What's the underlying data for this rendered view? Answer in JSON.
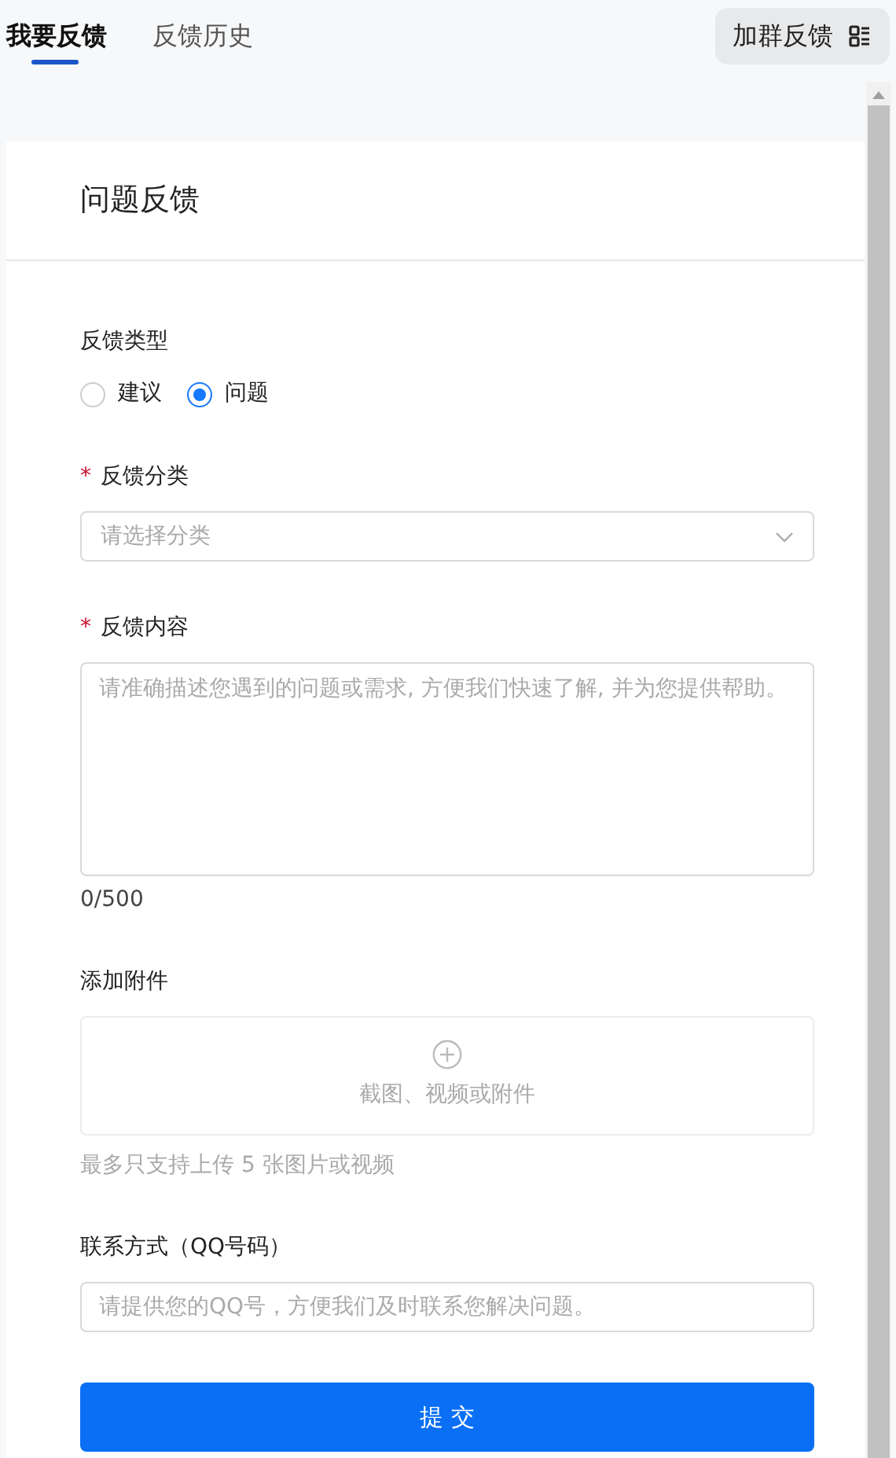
{
  "tabs": [
    {
      "label": "我要反馈",
      "selected": true
    },
    {
      "label": "反馈历史",
      "selected": false
    }
  ],
  "group_button": {
    "label": "加群反馈"
  },
  "form": {
    "title": "问题反馈",
    "fields": [
      {
        "kind": "radio",
        "label": "反馈类型",
        "options": [
          {
            "label": "建议",
            "selected": false
          },
          {
            "label": "问题",
            "selected": true
          }
        ]
      },
      {
        "kind": "select",
        "label": "反馈分类",
        "required_mark": "*",
        "placeholder": "请选择分类"
      },
      {
        "kind": "textarea",
        "label": "反馈内容",
        "required_mark": "*",
        "placeholder": "请准确描述您遇到的问题或需求, 方便我们快速了解, 并为您提供帮助。",
        "counter": "0/500"
      },
      {
        "kind": "upload",
        "label": "添加附件",
        "prompt": "截图、视频或附件",
        "hint": "最多只支持上传 5 张图片或视频"
      },
      {
        "kind": "text",
        "label": "联系方式（QQ号码）",
        "placeholder": "请提供您的QQ号，方便我们及时联系您解决问题。"
      }
    ],
    "submit": "提 交"
  }
}
